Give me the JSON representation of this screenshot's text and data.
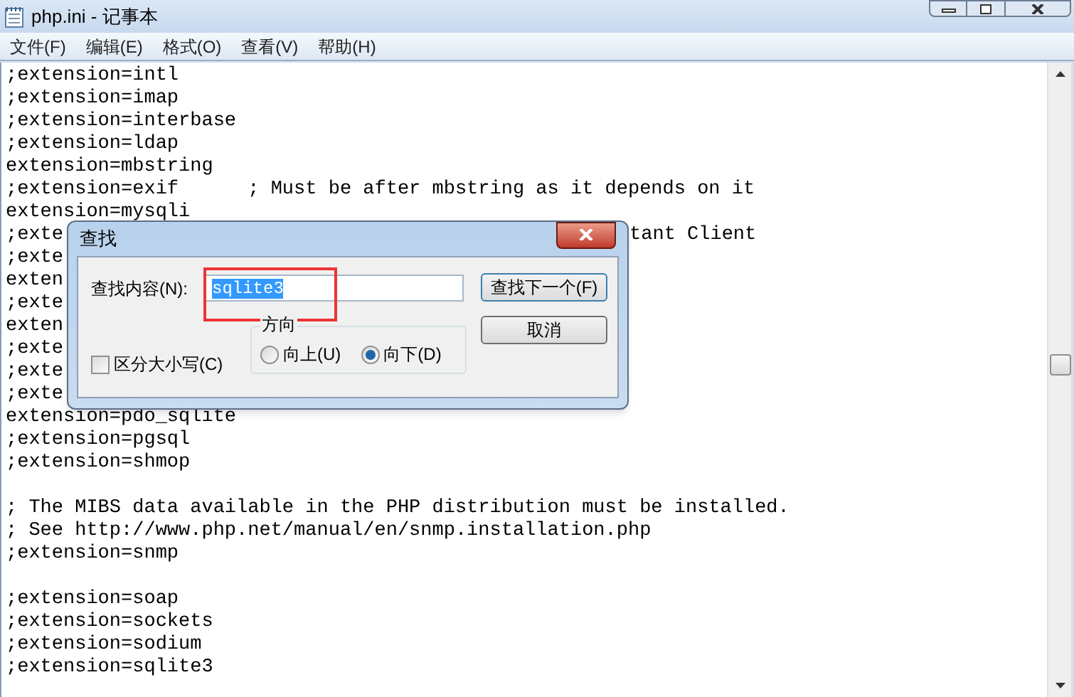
{
  "window": {
    "title": "php.ini - 记事本"
  },
  "menu": [
    "文件(F)",
    "编辑(E)",
    "格式(O)",
    "查看(V)",
    "帮助(H)"
  ],
  "blocks": [
    [
      {
        "text": ";extension=intl"
      },
      {
        "text": ";extension=imap"
      },
      {
        "text": ";extension=interbase"
      },
      {
        "text": ";extension=ldap"
      },
      {
        "text": "extension=mbstring"
      },
      {
        "text": ";extension=exif      ; Must be after mbstring as it depends on it"
      },
      {
        "text": "extension=mysqli"
      },
      {
        "text": ";exte",
        "tail": "tant Client"
      },
      {
        "text": ";exte"
      },
      {
        "text": "exten"
      },
      {
        "text": ";exte"
      },
      {
        "text": "exten"
      },
      {
        "text": ";exte"
      },
      {
        "text": ";exte"
      },
      {
        "text": ";exte"
      },
      {
        "text": "extension=pdo_sqlite"
      },
      {
        "text": ";extension=pgsql"
      },
      {
        "text": ";extension=shmop"
      }
    ],
    [
      {
        "text": "; The MIBS data available in the PHP distribution must be installed."
      },
      {
        "text": "; See http://www.php.net/manual/en/snmp.installation.php"
      },
      {
        "text": ";extension=snmp"
      }
    ],
    [
      {
        "text": ";extension=soap"
      },
      {
        "text": ";extension=sockets"
      },
      {
        "text": ";extension=sodium"
      },
      {
        "text": ";extension=sqlite3"
      }
    ]
  ],
  "find_dialog": {
    "title": "查找",
    "find_label": "查找内容(N):",
    "find_value": "sqlite3",
    "value_selected": true,
    "match_case": {
      "label": "区分大小写(C)",
      "checked": false
    },
    "direction": {
      "label": "方向",
      "options": [
        {
          "label": "向上(U)",
          "selected": false
        },
        {
          "label": "向下(D)",
          "selected": true
        }
      ]
    },
    "buttons": [
      {
        "label": "查找下一个(F)",
        "default": true
      },
      {
        "label": "取消",
        "default": false
      }
    ],
    "highlight_box": true
  }
}
